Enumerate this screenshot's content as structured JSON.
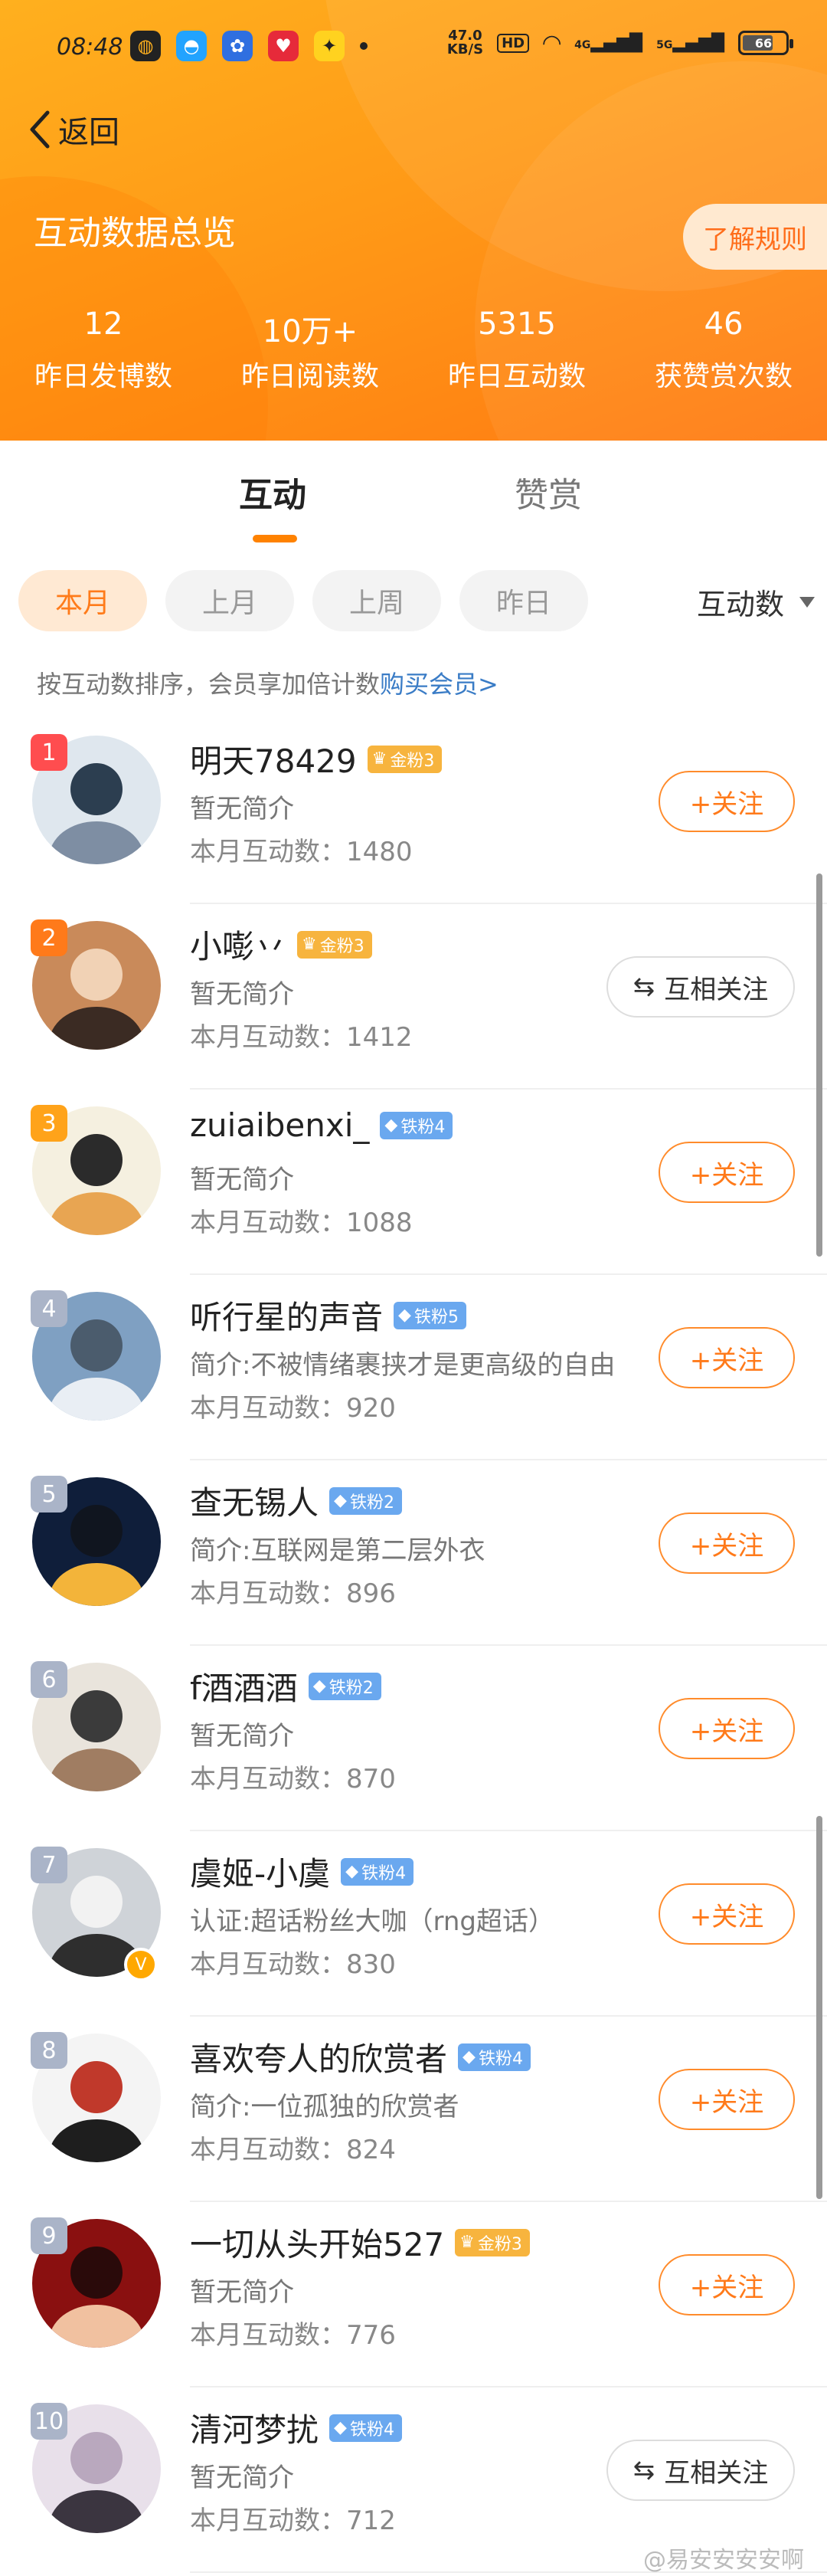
{
  "status_bar": {
    "time": "08:48",
    "speed_value": "47.0",
    "speed_unit": "KB/S",
    "hd": "HD",
    "signal1": "4G",
    "signal2": "5G",
    "battery": "66"
  },
  "nav": {
    "back_label": "返回"
  },
  "overview": {
    "title": "互动数据总览",
    "rules_button": "了解规则",
    "stats": [
      {
        "value": "12",
        "label": "昨日发博数"
      },
      {
        "value": "10万+",
        "label": "昨日阅读数"
      },
      {
        "value": "5315",
        "label": "昨日互动数"
      },
      {
        "value": "46",
        "label": "获赞赏次数"
      }
    ]
  },
  "tabs": {
    "active": "互动",
    "inactive": "赞赏"
  },
  "filters": {
    "chips": [
      "本月",
      "上月",
      "上周",
      "昨日"
    ],
    "active_chip": "本月",
    "sort_label": "互动数"
  },
  "tip": {
    "text": "按互动数排序，会员享加倍计数",
    "link": "购买会员>"
  },
  "colors": {
    "accent": "#ff8200",
    "header_start": "#ffb01e",
    "header_end": "#ff7a12",
    "link": "#3a7cc6"
  },
  "users": [
    {
      "rank": "1",
      "name": "明天78429",
      "badge": "金粉3",
      "badge_type": "gold",
      "desc": "暂无简介",
      "count": "本月互动数：1480",
      "action": "+关注",
      "action_type": "follow"
    },
    {
      "rank": "2",
      "name": "小嘭丷",
      "badge": "金粉3",
      "badge_type": "gold",
      "desc": "暂无简介",
      "count": "本月互动数：1412",
      "action": "互相关注",
      "action_type": "mutual"
    },
    {
      "rank": "3",
      "name": "zuiaibenxi_",
      "badge": "铁粉4",
      "badge_type": "iron",
      "desc": "暂无简介",
      "count": "本月互动数：1088",
      "action": "+关注",
      "action_type": "follow"
    },
    {
      "rank": "4",
      "name": "听行星的声音",
      "badge": "铁粉5",
      "badge_type": "iron",
      "desc": "简介:不被情绪裹挟才是更高级的自由",
      "count": "本月互动数：920",
      "action": "+关注",
      "action_type": "follow"
    },
    {
      "rank": "5",
      "name": "查无锡人",
      "badge": "铁粉2",
      "badge_type": "iron",
      "desc": "简介:互联网是第二层外衣",
      "count": "本月互动数：896",
      "action": "+关注",
      "action_type": "follow"
    },
    {
      "rank": "6",
      "name": "f酒酒酒",
      "badge": "铁粉2",
      "badge_type": "iron",
      "desc": "暂无简介",
      "count": "本月互动数：870",
      "action": "+关注",
      "action_type": "follow"
    },
    {
      "rank": "7",
      "name": "虞姬-小虞",
      "badge": "铁粉4",
      "badge_type": "iron",
      "desc": "认证:超话粉丝大咖（rng超话）",
      "count": "本月互动数：830",
      "action": "+关注",
      "action_type": "follow",
      "verified": true
    },
    {
      "rank": "8",
      "name": "喜欢夸人的欣赏者",
      "badge": "铁粉4",
      "badge_type": "iron",
      "desc": "简介:一位孤独的欣赏者",
      "count": "本月互动数：824",
      "action": "+关注",
      "action_type": "follow"
    },
    {
      "rank": "9",
      "name": "一切从头开始527",
      "badge": "金粉3",
      "badge_type": "gold",
      "desc": "暂无简介",
      "count": "本月互动数：776",
      "action": "+关注",
      "action_type": "follow"
    },
    {
      "rank": "10",
      "name": "清河梦扰",
      "badge": "铁粉4",
      "badge_type": "iron",
      "desc": "暂无简介",
      "count": "本月互动数：712",
      "action": "互相关注",
      "action_type": "mutual"
    }
  ],
  "watermark": "@易安安安安啊"
}
